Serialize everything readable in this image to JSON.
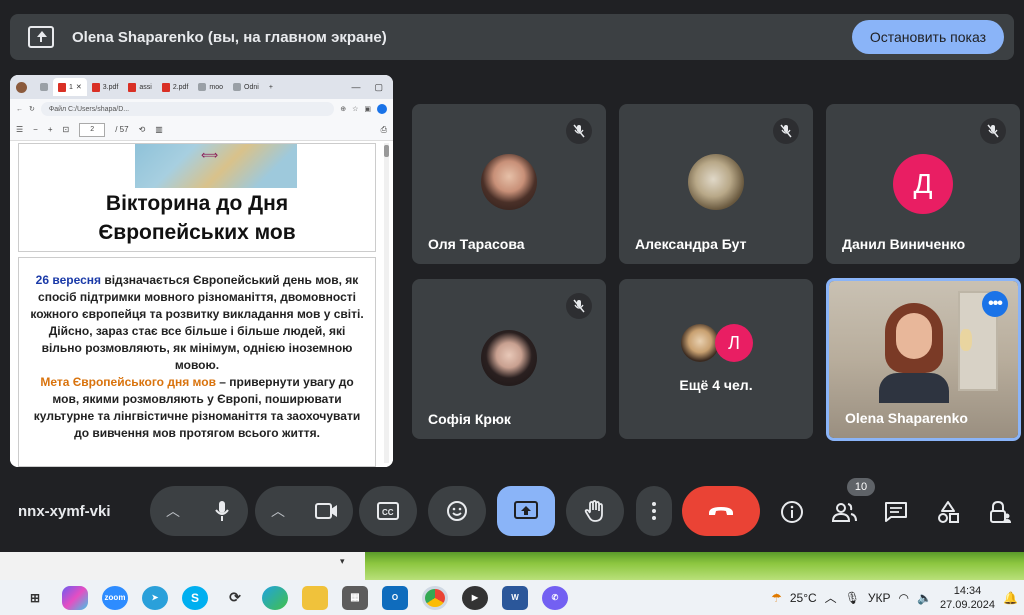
{
  "banner": {
    "title": "Olena Shaparenko (вы, на главном экране)",
    "stop_label": "Остановить показ"
  },
  "shared": {
    "tabs": [
      "1",
      "3.pdf",
      "assi",
      "2.pdf",
      "moo",
      "Odni"
    ],
    "address": "Файл   C:/Users/shapa/D...",
    "page_current": "2",
    "page_total": "/ 57",
    "slide_title_line1": "Вікторина до Дня",
    "slide_title_line2": "Європейських мов",
    "p1_highlight": "26 вересня",
    "p1_text": " відзначається Європейський день мов, як спосіб підтримки мовного різноманіття, двомовності кожного європейця та розвитку викладання мов у світі. Дійсно, зараз стає все більше і більше людей, які вільно розмовляють, як мінімум, однією іноземною мовою.",
    "p2_highlight": "Мета Європейського дня мов",
    "p2_text": " – привернути увагу до мов, якими розмовляють у Європі, поширювати культурне та лінгвістичне різноманіття та заохочувати до вивчення мов протягом всього життя."
  },
  "participants": [
    {
      "name": "Оля Тарасова"
    },
    {
      "name": "Александра Бут"
    },
    {
      "name": "Данил Виниченко",
      "initial": "Д"
    },
    {
      "name": "Софія Крюк"
    },
    {
      "name": "Ещё 4 чел.",
      "initial": "Л"
    },
    {
      "name": "Olena Shaparenko"
    }
  ],
  "meeting_code": "nnx-xymf-vki",
  "people_count": "10",
  "taskbar": {
    "teams_label": "zoom",
    "weather": "25°C",
    "lang": "УКР",
    "time": "14:34",
    "date": "27.09.2024"
  },
  "colors": {
    "accent": "#8ab4f8",
    "end_call": "#ea4335",
    "tile": "#3c4043",
    "avatar_pink": "#e91e63"
  }
}
